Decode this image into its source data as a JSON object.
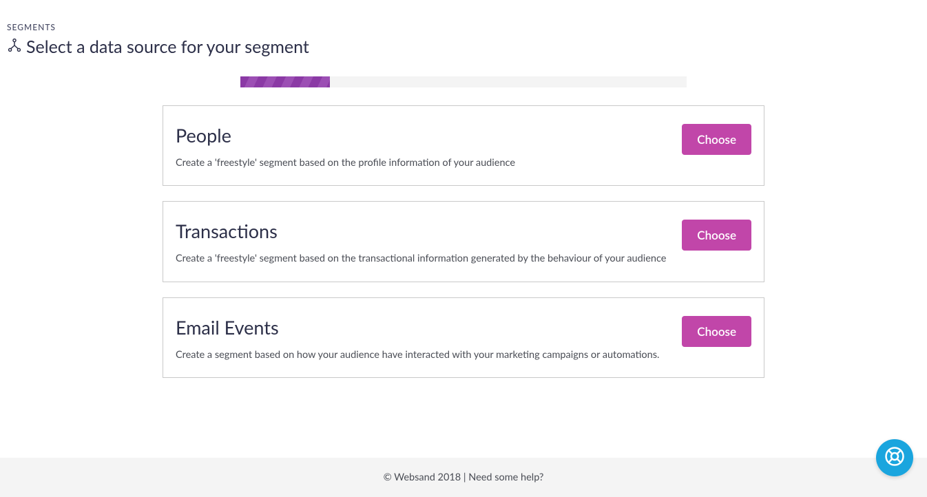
{
  "header": {
    "breadcrumb": "SEGMENTS",
    "title": "Select a data source for your segment"
  },
  "progress": {
    "percent": 20
  },
  "cards": [
    {
      "title": "People",
      "description": "Create a 'freestyle' segment based on the profile information of your audience",
      "button": "Choose"
    },
    {
      "title": "Transactions",
      "description": "Create a 'freestyle' segment based on the transactional information generated by the behaviour of your audience",
      "button": "Choose"
    },
    {
      "title": "Email Events",
      "description": "Create a segment based on how your audience have interacted with your marketing campaigns or automations.",
      "button": "Choose"
    }
  ],
  "footer": {
    "copyright": "© Websand 2018",
    "separator": " | ",
    "help_link": "Need some help?"
  }
}
